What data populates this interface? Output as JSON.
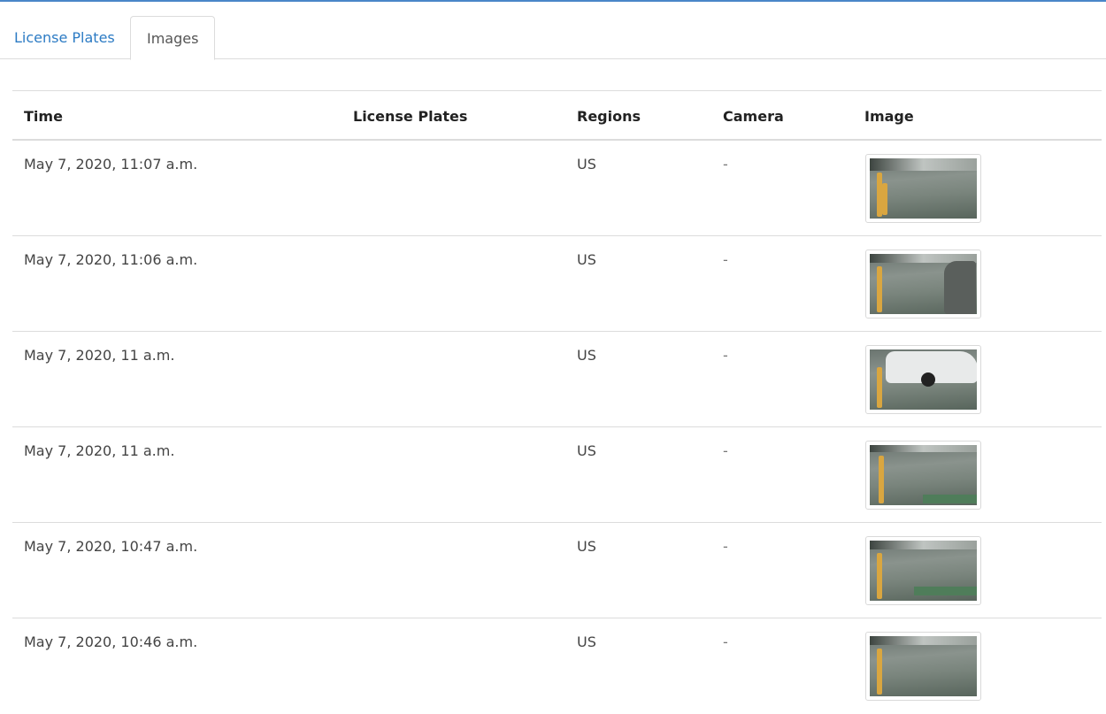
{
  "tabs": [
    {
      "label": "License Plates",
      "active": false
    },
    {
      "label": "Images",
      "active": true
    }
  ],
  "table": {
    "columns": [
      "Time",
      "License Plates",
      "Regions",
      "Camera",
      "Image"
    ],
    "rows": [
      {
        "time": "May 7, 2020, 11:07 a.m.",
        "plates": "",
        "regions": "US",
        "camera": "-",
        "image": "parking-camera-thumbnail"
      },
      {
        "time": "May 7, 2020, 11:06 a.m.",
        "plates": "",
        "regions": "US",
        "camera": "-",
        "image": "parking-camera-thumbnail"
      },
      {
        "time": "May 7, 2020, 11 a.m.",
        "plates": "",
        "regions": "US",
        "camera": "-",
        "image": "parking-camera-thumbnail-car"
      },
      {
        "time": "May 7, 2020, 11 a.m.",
        "plates": "",
        "regions": "US",
        "camera": "-",
        "image": "parking-camera-thumbnail"
      },
      {
        "time": "May 7, 2020, 10:47 a.m.",
        "plates": "",
        "regions": "US",
        "camera": "-",
        "image": "parking-camera-thumbnail"
      },
      {
        "time": "May 7, 2020, 10:46 a.m.",
        "plates": "",
        "regions": "US",
        "camera": "-",
        "image": "parking-camera-thumbnail"
      }
    ]
  },
  "colors": {
    "accent": "#2c7bc4",
    "border": "#dcdcdc",
    "topline": "#4a86c8"
  }
}
